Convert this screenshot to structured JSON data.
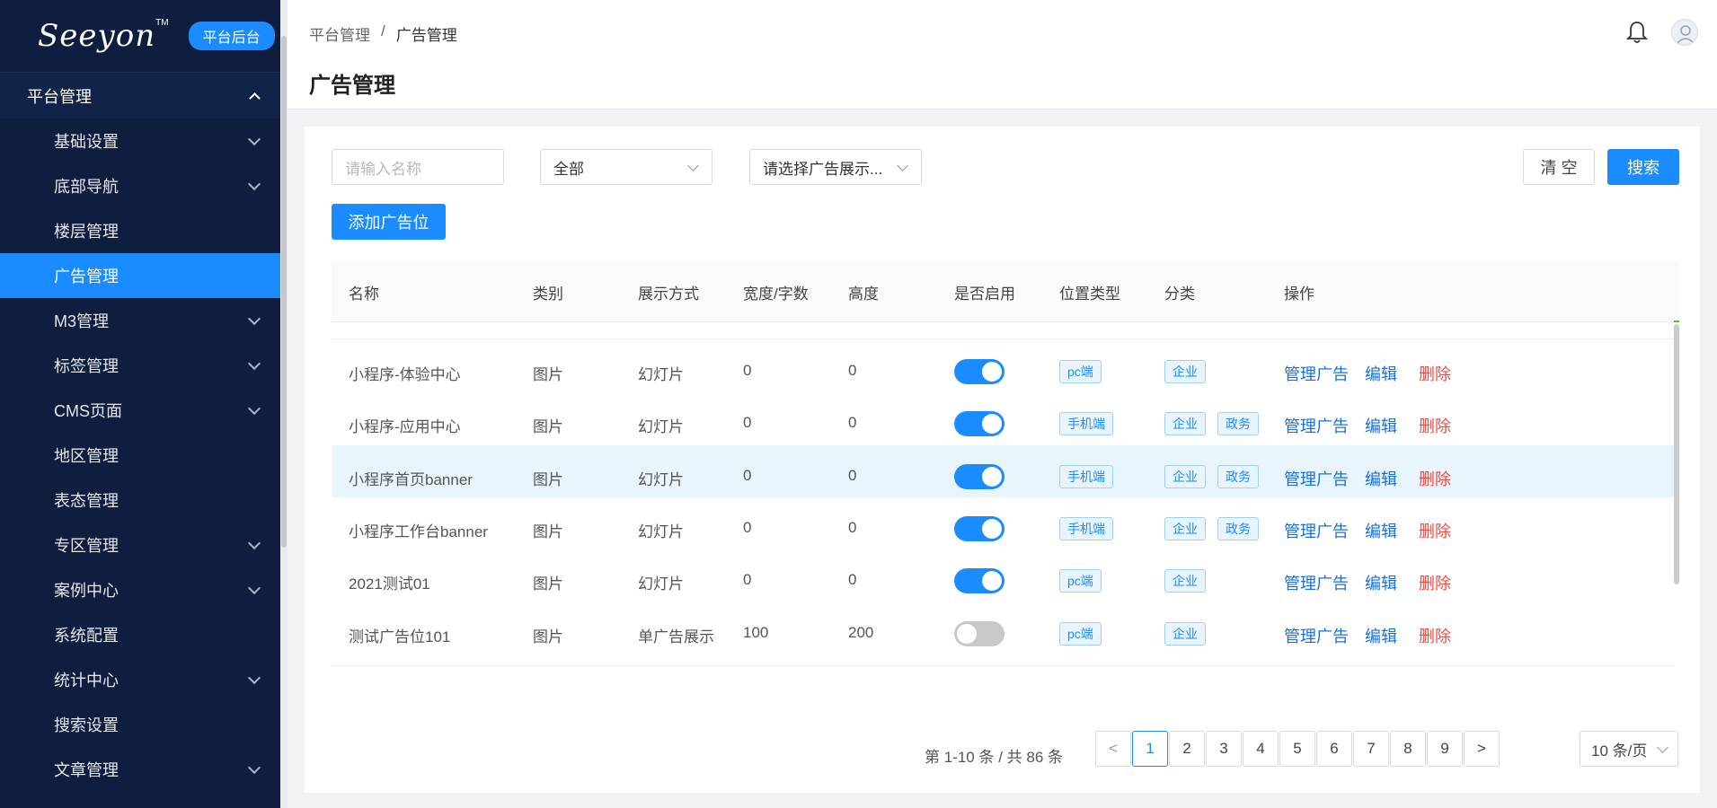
{
  "sidebar": {
    "logo": "Seeyon",
    "logo_tm": "TM",
    "badge": "平台后台",
    "group": "平台管理",
    "items": [
      {
        "label": "基础设置",
        "expandable": true
      },
      {
        "label": "底部导航",
        "expandable": true
      },
      {
        "label": "楼层管理",
        "expandable": false
      },
      {
        "label": "广告管理",
        "expandable": false,
        "active": true
      },
      {
        "label": "M3管理",
        "expandable": true
      },
      {
        "label": "标签管理",
        "expandable": true
      },
      {
        "label": "CMS页面",
        "expandable": true
      },
      {
        "label": "地区管理",
        "expandable": false
      },
      {
        "label": "表态管理",
        "expandable": false
      },
      {
        "label": "专区管理",
        "expandable": true
      },
      {
        "label": "案例中心",
        "expandable": true
      },
      {
        "label": "系统配置",
        "expandable": false
      },
      {
        "label": "统计中心",
        "expandable": true
      },
      {
        "label": "搜索设置",
        "expandable": false
      },
      {
        "label": "文章管理",
        "expandable": true
      }
    ]
  },
  "header": {
    "breadcrumb": [
      "平台管理",
      "/",
      "广告管理"
    ],
    "title": "广告管理"
  },
  "filters": {
    "name_placeholder": "请输入名称",
    "category_value": "全部",
    "display_placeholder": "请选择广告展示...",
    "clear_label": "清 空",
    "search_label": "搜索",
    "add_label": "添加广告位"
  },
  "table": {
    "columns": [
      "名称",
      "类别",
      "展示方式",
      "宽度/字数",
      "高度",
      "是否启用",
      "位置类型",
      "分类",
      "操作"
    ],
    "rows": [
      {
        "name": "小程序-体验中心",
        "type": "图片",
        "display": "幻灯片",
        "width": "0",
        "height": "0",
        "enabled": true,
        "position": "pc端",
        "categories": [
          "企业"
        ]
      },
      {
        "name": "小程序-应用中心",
        "type": "图片",
        "display": "幻灯片",
        "width": "0",
        "height": "0",
        "enabled": true,
        "position": "手机端",
        "categories": [
          "企业",
          "政务"
        ]
      },
      {
        "name": "小程序首页banner",
        "type": "图片",
        "display": "幻灯片",
        "width": "0",
        "height": "0",
        "enabled": true,
        "position": "手机端",
        "categories": [
          "企业",
          "政务"
        ]
      },
      {
        "name": "小程序工作台banner",
        "type": "图片",
        "display": "幻灯片",
        "width": "0",
        "height": "0",
        "enabled": true,
        "position": "手机端",
        "categories": [
          "企业",
          "政务"
        ]
      },
      {
        "name": "2021测试01",
        "type": "图片",
        "display": "幻灯片",
        "width": "0",
        "height": "0",
        "enabled": true,
        "position": "pc端",
        "categories": [
          "企业"
        ]
      },
      {
        "name": "测试广告位101",
        "type": "图片",
        "display": "单广告展示",
        "width": "100",
        "height": "200",
        "enabled": false,
        "position": "pc端",
        "categories": [
          "企业"
        ]
      }
    ],
    "actions": {
      "manage": "管理广告",
      "edit": "编辑",
      "delete": "删除"
    }
  },
  "pagination": {
    "total_text": "第 1-10 条 / 共 86 条",
    "prev": "<",
    "next": ">",
    "pages": [
      "1",
      "2",
      "3",
      "4",
      "5",
      "6",
      "7",
      "8",
      "9"
    ],
    "current": "1",
    "page_size": "10 条/页"
  },
  "colors": {
    "sidebar_bg": "#0f1e3f",
    "accent": "#1a8cff",
    "danger": "#ef4b3f",
    "hover_row": "#e8f5fc"
  }
}
